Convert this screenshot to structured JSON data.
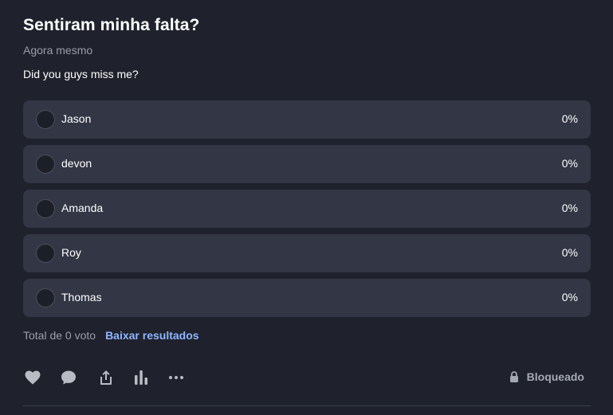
{
  "poll": {
    "title": "Sentiram minha falta?",
    "timestamp": "Agora mesmo",
    "question": "Did you guys miss me?",
    "options": [
      {
        "label": "Jason",
        "percent": "0%"
      },
      {
        "label": "devon",
        "percent": "0%"
      },
      {
        "label": "Amanda",
        "percent": "0%"
      },
      {
        "label": "Roy",
        "percent": "0%"
      },
      {
        "label": "Thomas",
        "percent": "0%"
      }
    ],
    "total_votes": "Total de 0 voto",
    "download_label": "Baixar resultados"
  },
  "actions": {
    "icons": [
      "heart-icon",
      "comment-icon",
      "share-icon",
      "bar-chart-icon",
      "more-icon"
    ],
    "locked_label": "Bloqueado",
    "locked_icon": "lock-icon"
  },
  "colors": {
    "background": "#1f222c",
    "option_bg": "#323645",
    "link": "#8fb4ff",
    "muted": "#9a9ea8"
  }
}
